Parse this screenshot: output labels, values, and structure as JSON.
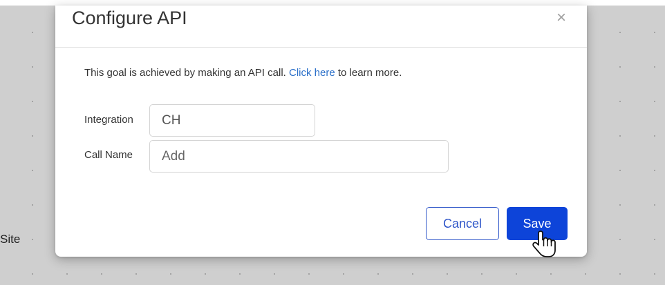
{
  "canvas": {
    "partial_label": "Site"
  },
  "modal": {
    "title": "Configure API",
    "close_symbol": "×",
    "description": {
      "before": "This goal is achieved by making an API call.  ",
      "link": "Click here",
      "after": " to learn more."
    },
    "fields": [
      {
        "label": "Integration",
        "value": "CH",
        "placeholder": ""
      },
      {
        "label": "Call Name",
        "value": "",
        "placeholder": "Add"
      }
    ],
    "buttons": {
      "cancel": "Cancel",
      "save": "Save"
    }
  },
  "colors": {
    "primary": "#0d44d9",
    "link": "#2a6fc9",
    "canvas_bg": "#cfcfcf"
  },
  "icons": {
    "close": "close-icon",
    "cursor": "hand-pointer-icon"
  }
}
